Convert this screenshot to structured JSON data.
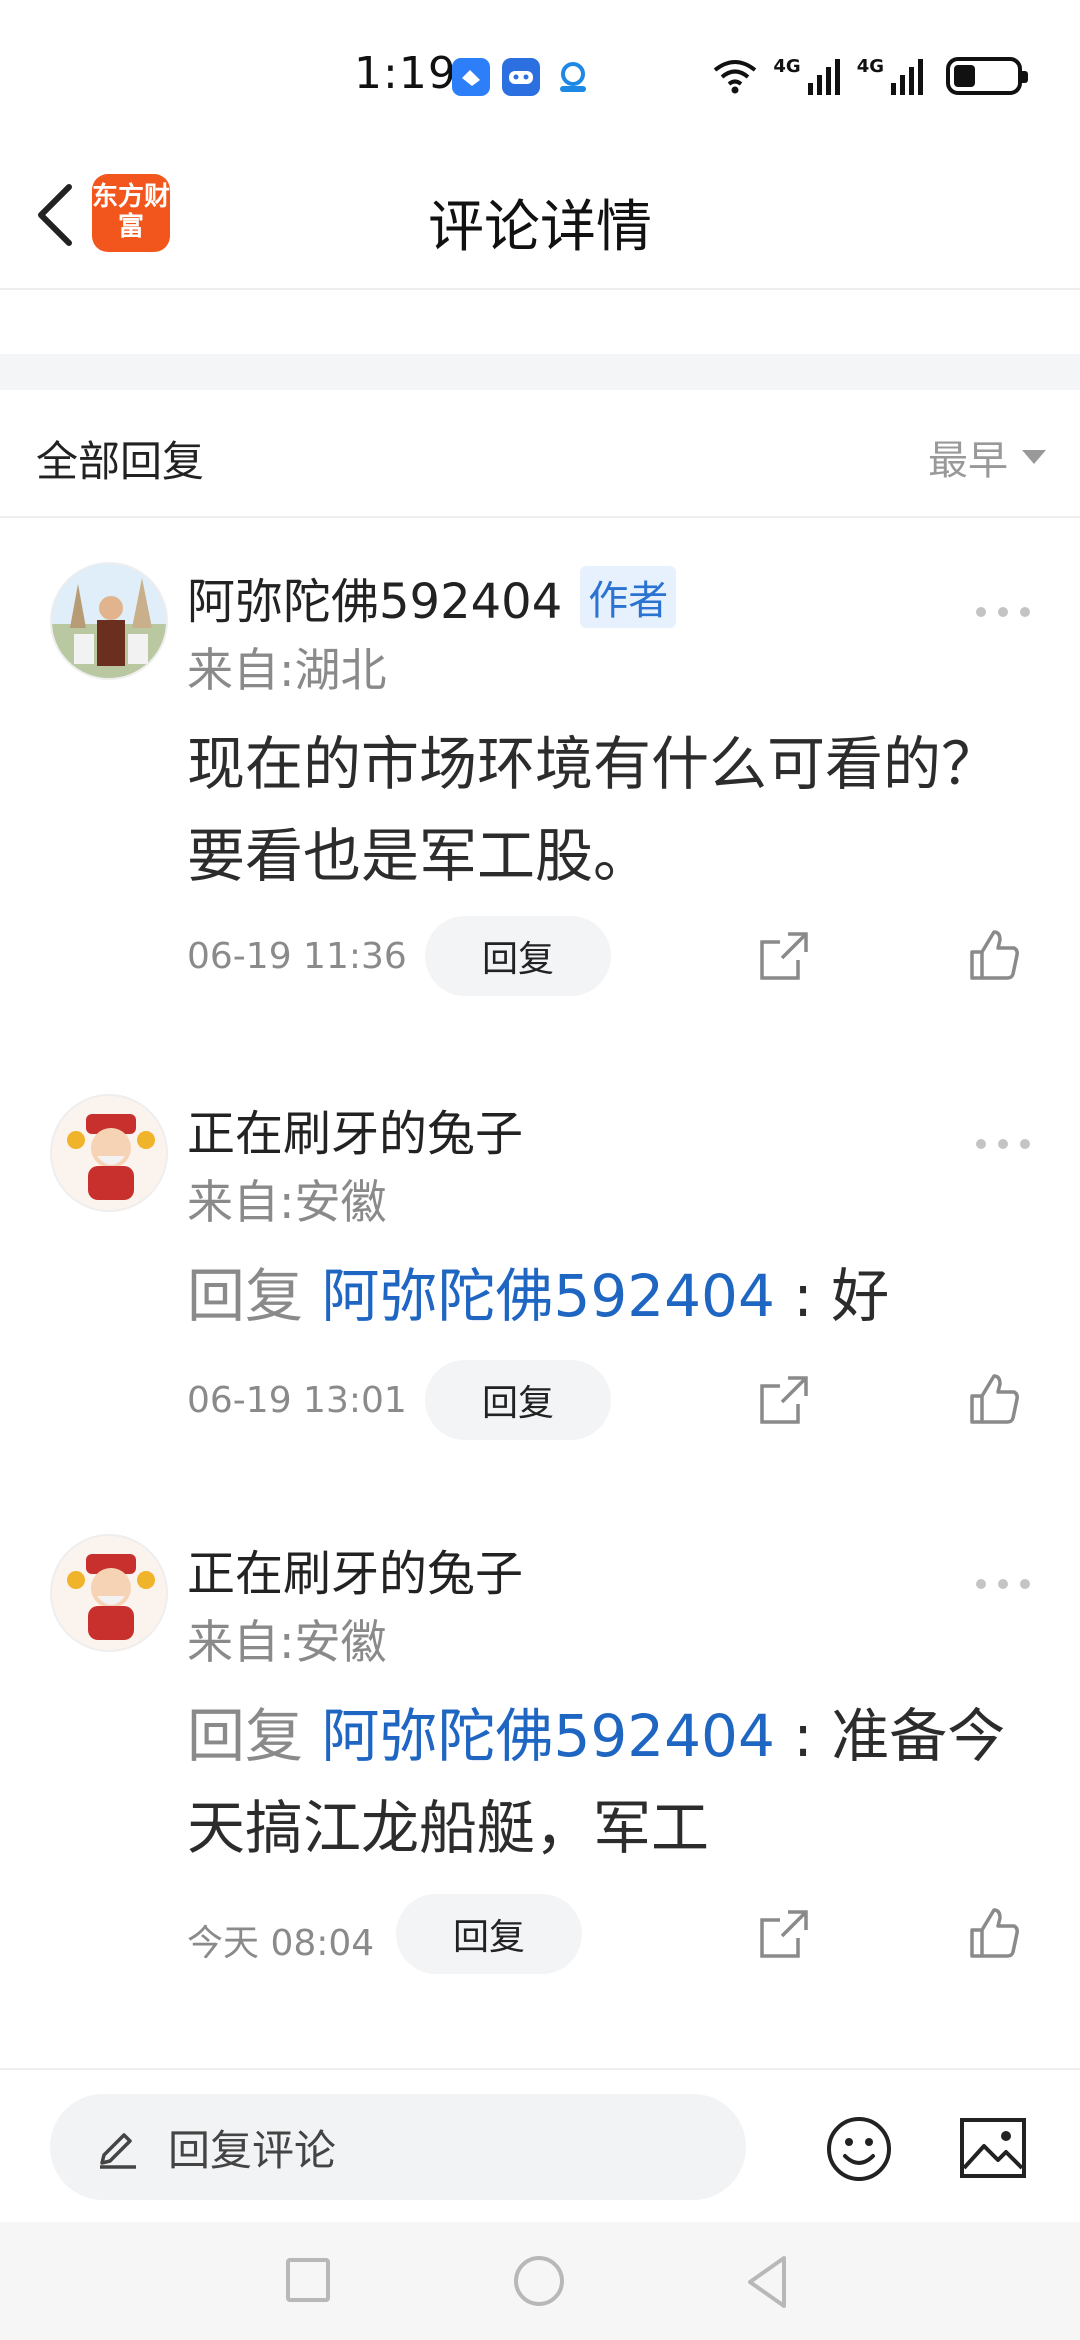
{
  "status_bar": {
    "time": "1:19",
    "signal_labels": [
      "4G",
      "4G"
    ],
    "battery_level": 0.35
  },
  "header": {
    "app_logo": "东方财富",
    "title": "评论详情"
  },
  "section": {
    "title": "全部回复",
    "sort_label": "最早"
  },
  "comments": [
    {
      "name": "阿弥陀佛592404",
      "badge": "作者",
      "location": "来自:湖北",
      "text": "现在的市场环境有什么可看的？要看也是军工股。",
      "time": "06-19 11:36",
      "reply_label": "回复"
    },
    {
      "name": "正在刷牙的兔子",
      "location": "来自:安徽",
      "reply_prefix": "回复",
      "reply_target": "阿弥陀佛592404",
      "text": " : 好",
      "time": "06-19 13:01",
      "reply_label": "回复"
    },
    {
      "name": "正在刷牙的兔子",
      "location": "来自:安徽",
      "reply_prefix": "回复",
      "reply_target": "阿弥陀佛592404",
      "text": " : 准备今天搞江龙船艇，军工",
      "time": "今天 08:04",
      "reply_label": "回复"
    }
  ],
  "input_bar": {
    "placeholder": "回复评论",
    "icons": [
      "pencil-icon",
      "emoji-icon",
      "image-icon"
    ]
  },
  "nav_icons": [
    "recents-icon",
    "home-icon",
    "back-icon"
  ],
  "colors": {
    "brand": "#f2561d",
    "link_blue": "#1f66c2",
    "badge_bg": "#e6f1fd"
  }
}
